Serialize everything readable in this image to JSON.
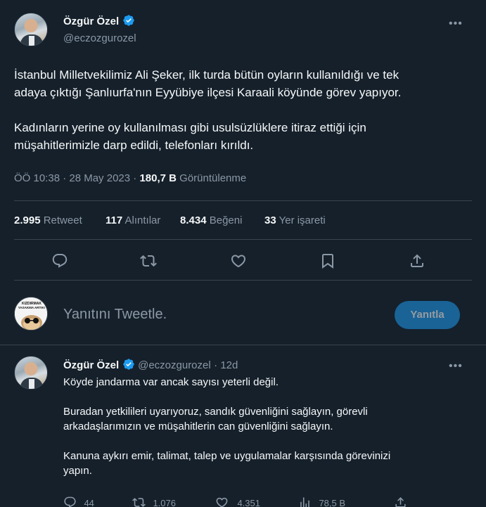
{
  "main_tweet": {
    "author_name": "Özgür Özel",
    "author_handle": "@eczozgurozel",
    "paragraph1_line1": "İstanbul Milletvekilimiz Ali Şeker, ilk turda bütün oyların kullanıldığı ve tek",
    "paragraph1_line2": "adaya çıktığı Şanlıurfa'nın Eyyübiye ilçesi Karaali köyünde görev yapıyor.",
    "paragraph2_line1": "Kadınların yerine oy kullanılması gibi usulsüzlüklere itiraz ettiği için",
    "paragraph2_line2": "müşahitlerimizle darp edildi, telefonları kırıldı.",
    "timestamp": "ÖÖ 10:38 · 28 May 2023 ·",
    "views_count": "180,7 B",
    "views_label": "Görüntülenme",
    "stats": {
      "retweets_count": "2.995",
      "retweets_label": "Retweet",
      "quotes_count": "117",
      "quotes_label": "Alıntılar",
      "likes_count": "8.434",
      "likes_label": "Beğeni",
      "bookmarks_count": "33",
      "bookmarks_label": "Yer işareti"
    }
  },
  "reply_composer": {
    "avatar_text_top": "KIZDIRMAK",
    "avatar_text_bottom": "YASAKMA ARTIK!",
    "placeholder": "Yanıtını Tweetle.",
    "button_label": "Yanıtla"
  },
  "reply_tweet": {
    "author_name": "Özgür Özel",
    "author_handle": "@eczozgurozel",
    "time_ago": "· 12d",
    "line1": "Köyde jandarma var ancak sayısı yeterli değil.",
    "line2": "Buradan yetkilileri uyarıyoruz, sandık güvenliğini sağlayın, görevli",
    "line3": "arkadaşlarımızın ve müşahitlerin can güvenliğini sağlayın.",
    "line4": "Kanuna aykırı emir, talimat, talep ve uygulamalar karşısında görevinizi",
    "line5": "yapın.",
    "actions": {
      "replies": "44",
      "retweets": "1.076",
      "likes": "4.351",
      "views": "78,5 B"
    }
  },
  "colors": {
    "background": "#15202b",
    "text": "#f7f9f9",
    "secondary": "#8b98a5",
    "accent": "#1d9bf0",
    "divider": "#38444d"
  }
}
